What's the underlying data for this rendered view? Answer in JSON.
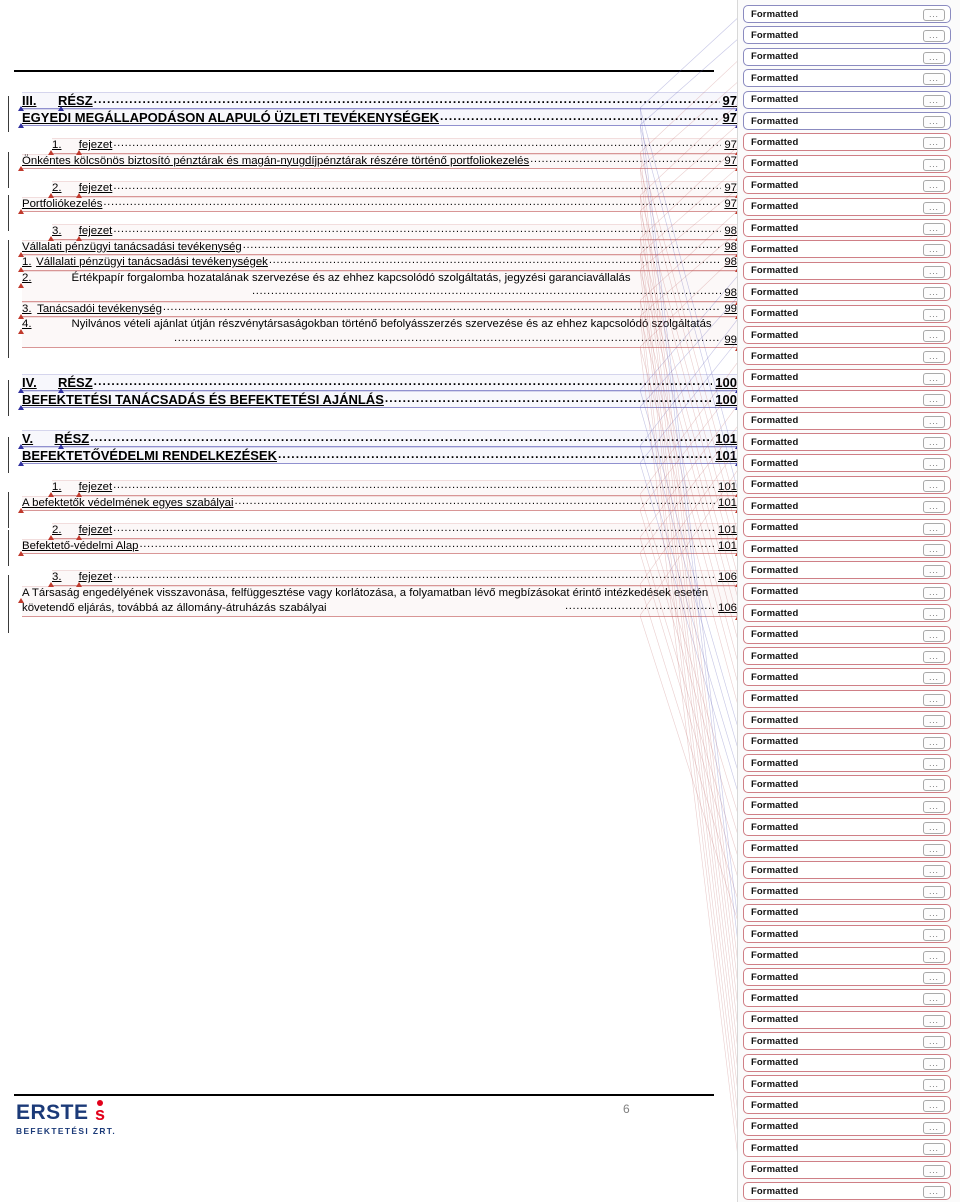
{
  "document": {
    "page_number": "6",
    "logo": {
      "word": "ERSTE",
      "mark": "s",
      "subtitle": "BEFEKTETÉSI ZRT."
    }
  },
  "toc": {
    "groups": [
      {
        "id": "part-3",
        "level": "part",
        "change_color": "blue",
        "lines": [
          {
            "num": "III.",
            "label": "RÉSZ",
            "page": "97",
            "style": "lvl1",
            "tc": "blue"
          },
          {
            "num": "",
            "label": "EGYEDI MEGÁLLAPODÁSON ALAPULÓ ÜZLETI TEVÉKENYSÉGEK",
            "page": "97",
            "style": "lvl1",
            "tc": "blue"
          }
        ]
      },
      {
        "id": "part-3-ch-1",
        "level": "chapter",
        "change_color": "red",
        "lines": [
          {
            "num": "1.",
            "label": "fejezet",
            "page": "97",
            "style": "ch",
            "tc": "red"
          },
          {
            "num": "",
            "label": "Önkéntes kölcsönös biztosító pénztárak és magán-nyugdíjpénztárak részére történő portfoliokezelés",
            "page": "97",
            "style": "ch-title",
            "tc": "red"
          }
        ]
      },
      {
        "id": "part-3-ch-2",
        "level": "chapter",
        "change_color": "red",
        "lines": [
          {
            "num": "2.",
            "label": "fejezet",
            "page": "97",
            "style": "ch",
            "tc": "red"
          },
          {
            "num": "",
            "label": "Portfoliókezelés",
            "page": "97",
            "style": "ch-title",
            "tc": "red"
          }
        ]
      },
      {
        "id": "part-3-ch-3",
        "level": "chapter",
        "change_color": "red",
        "lines": [
          {
            "num": "3.",
            "label": "fejezet",
            "page": "98",
            "style": "ch",
            "tc": "red"
          },
          {
            "num": "",
            "label": "Vállalati pénzügyi tanácsadási tevékenység",
            "page": "98",
            "style": "ch-title",
            "tc": "red"
          },
          {
            "num": "1.",
            "label": "Vállalati pénzügyi tanácsadási  tevékenységek",
            "page": "98",
            "style": "sub",
            "tc": "red"
          },
          {
            "num": "2.",
            "label": "Értékpapír forgalomba hozatalának szervezése és az ehhez kapcsolódó szolgáltatás, jegyzési garanciavállalás",
            "page": "98",
            "style": "sub-wrap",
            "tc": "red"
          },
          {
            "num": "3.",
            "label": "Tanácsadói tevékenység",
            "page": "99",
            "style": "sub",
            "tc": "red"
          },
          {
            "num": "4.",
            "label": "Nyilvános vételi ajánlat útján részvénytársaságokban történő befolyásszerzés szervezése és az ehhez kapcsolódó szolgáltatás",
            "page": "99",
            "style": "sub-wrap",
            "tc": "red"
          }
        ]
      },
      {
        "id": "part-4",
        "level": "part",
        "change_color": "blue",
        "lines": [
          {
            "num": "IV.",
            "label": "RÉSZ",
            "page": "100",
            "style": "lvl1",
            "tc": "blue"
          },
          {
            "num": "",
            "label": "BEFEKTETÉSI TANÁCSADÁS ÉS BEFEKTETÉSI AJÁNLÁS",
            "page": "100",
            "style": "lvl1",
            "tc": "blue"
          }
        ]
      },
      {
        "id": "part-5",
        "level": "part",
        "change_color": "blue",
        "lines": [
          {
            "num": "V.",
            "label": "RÉSZ",
            "page": "101",
            "style": "lvl1",
            "tc": "blue"
          },
          {
            "num": "",
            "label": "BEFEKTETŐVÉDELMI RENDELKEZÉSEK",
            "page": "101",
            "style": "lvl1",
            "tc": "blue"
          }
        ]
      },
      {
        "id": "part-5-ch-1",
        "level": "chapter",
        "change_color": "red",
        "lines": [
          {
            "num": "1.",
            "label": "fejezet",
            "page": "101",
            "style": "ch",
            "tc": "red"
          },
          {
            "num": "",
            "label": "A befektetők védelmének egyes szabályai",
            "page": "101",
            "style": "ch-title",
            "tc": "red"
          }
        ]
      },
      {
        "id": "part-5-ch-2",
        "level": "chapter",
        "change_color": "red",
        "lines": [
          {
            "num": "2.",
            "label": "fejezet",
            "page": "101",
            "style": "ch",
            "tc": "red"
          },
          {
            "num": "",
            "label": "Befektető-védelmi Alap",
            "page": "101",
            "style": "ch-title",
            "tc": "red"
          }
        ]
      },
      {
        "id": "part-5-ch-3",
        "level": "chapter",
        "change_color": "red",
        "lines": [
          {
            "num": "3.",
            "label": "fejezet",
            "page": "106",
            "style": "ch",
            "tc": "red"
          },
          {
            "num": "",
            "label": "A Társaság engedélyének visszavonása, felfüggesztése vagy korlátozása, a folyamatban lévő megbízásokat érintő intézkedések esetén követendő eljárás, továbbá az  állomány-átruházás szabályai",
            "page": "106",
            "style": "ch-title-wrap",
            "tc": "red"
          }
        ]
      }
    ]
  },
  "markup": {
    "balloon_label": "Formatted",
    "more_label": "...",
    "colors": {
      "blue_border": "#8b8bc0",
      "red_border": "#cf7f86"
    },
    "balloons": [
      {
        "color": "blue"
      },
      {
        "color": "blue"
      },
      {
        "color": "blue"
      },
      {
        "color": "blue"
      },
      {
        "color": "blue"
      },
      {
        "color": "blue"
      },
      {
        "color": "red"
      },
      {
        "color": "red"
      },
      {
        "color": "red"
      },
      {
        "color": "red"
      },
      {
        "color": "red"
      },
      {
        "color": "red"
      },
      {
        "color": "red"
      },
      {
        "color": "red"
      },
      {
        "color": "red"
      },
      {
        "color": "red"
      },
      {
        "color": "red"
      },
      {
        "color": "red"
      },
      {
        "color": "red"
      },
      {
        "color": "red"
      },
      {
        "color": "red"
      },
      {
        "color": "red"
      },
      {
        "color": "red"
      },
      {
        "color": "red"
      },
      {
        "color": "red"
      },
      {
        "color": "red"
      },
      {
        "color": "red"
      },
      {
        "color": "red"
      },
      {
        "color": "red"
      },
      {
        "color": "red"
      },
      {
        "color": "red"
      },
      {
        "color": "red"
      },
      {
        "color": "red"
      },
      {
        "color": "red"
      },
      {
        "color": "red"
      },
      {
        "color": "red"
      },
      {
        "color": "red"
      },
      {
        "color": "red"
      },
      {
        "color": "red"
      },
      {
        "color": "red"
      },
      {
        "color": "red"
      },
      {
        "color": "red"
      },
      {
        "color": "red"
      },
      {
        "color": "red"
      },
      {
        "color": "red"
      },
      {
        "color": "red"
      },
      {
        "color": "red"
      },
      {
        "color": "red"
      },
      {
        "color": "red"
      },
      {
        "color": "red"
      },
      {
        "color": "red"
      },
      {
        "color": "red"
      },
      {
        "color": "red"
      },
      {
        "color": "red"
      },
      {
        "color": "red"
      },
      {
        "color": "red"
      }
    ]
  }
}
